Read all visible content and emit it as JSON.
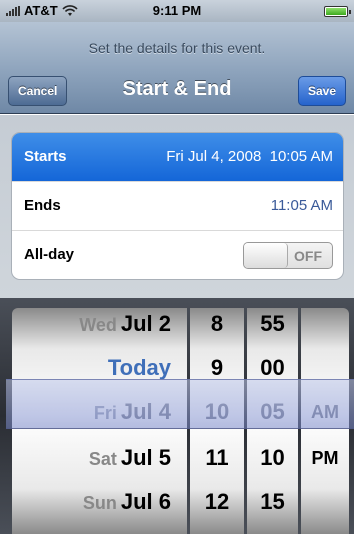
{
  "status_bar": {
    "carrier": "AT&T",
    "time": "9:11 PM"
  },
  "nav": {
    "prompt": "Set the details for this event.",
    "title": "Start & End",
    "cancel_label": "Cancel",
    "save_label": "Save"
  },
  "rows": [
    {
      "label": "Starts",
      "value": "Fri Jul 4, 2008  10:05 AM"
    },
    {
      "label": "Ends",
      "value": "11:05 AM"
    },
    {
      "label": "All-day",
      "toggle": "OFF"
    }
  ],
  "picker": {
    "dates": [
      {
        "day": "Wed",
        "date": "Jul 2"
      },
      {
        "day": "",
        "date": "Today"
      },
      {
        "day": "Fri",
        "date": "Jul 4"
      },
      {
        "day": "Sat",
        "date": "Jul 5"
      },
      {
        "day": "Sun",
        "date": "Jul 6"
      }
    ],
    "hours": [
      "8",
      "9",
      "10",
      "11",
      "12"
    ],
    "minutes": [
      "55",
      "00",
      "05",
      "10",
      "15"
    ],
    "ampm": [
      "",
      "",
      "AM",
      "PM",
      ""
    ]
  }
}
